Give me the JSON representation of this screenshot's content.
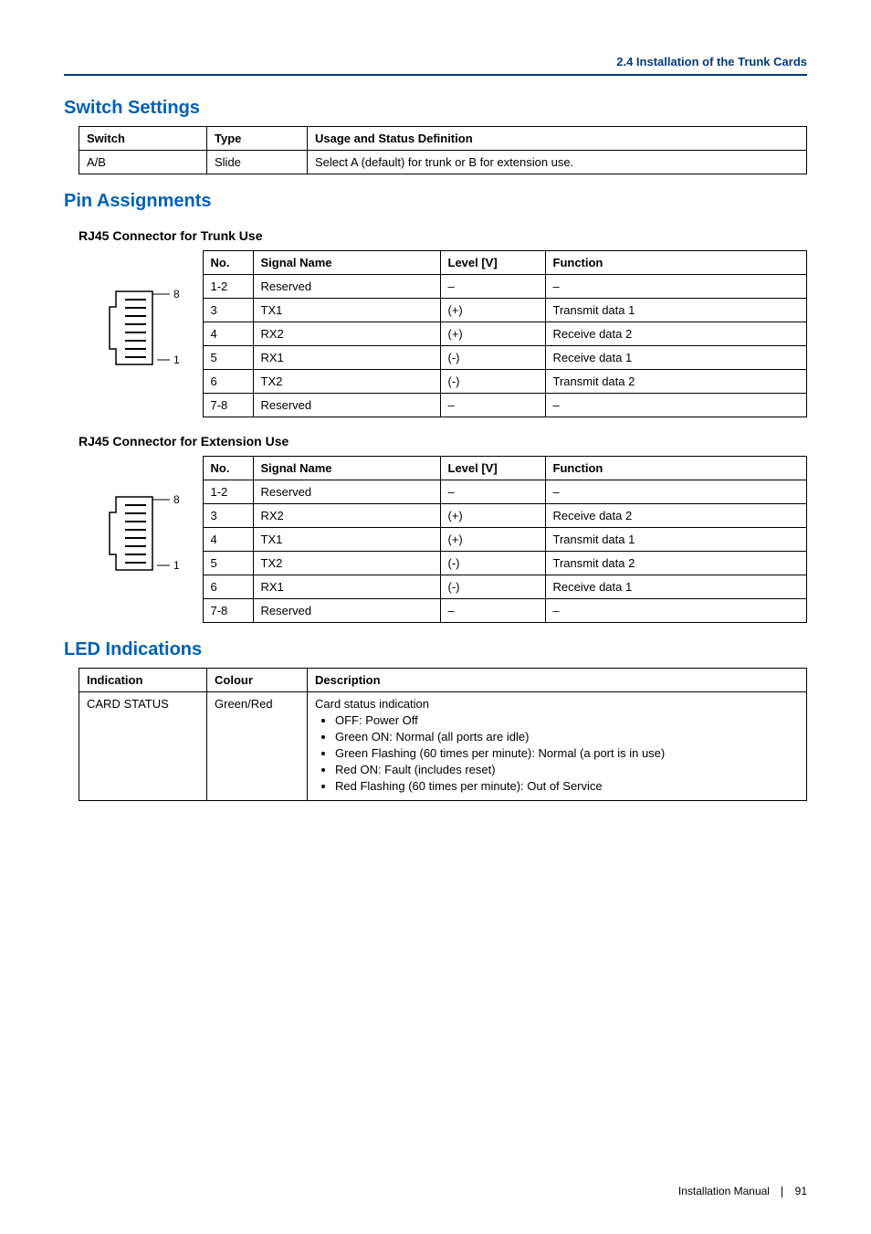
{
  "header": {
    "section_ref": "2.4 Installation of the Trunk Cards"
  },
  "switch_settings": {
    "title": "Switch Settings",
    "columns": {
      "c1": "Switch",
      "c2": "Type",
      "c3": "Usage and Status Definition"
    },
    "rows": [
      {
        "switch": "A/B",
        "type": "Slide",
        "usage": "Select A (default) for trunk or B for extension use."
      }
    ]
  },
  "pin_assignments": {
    "title": "Pin Assignments",
    "trunk": {
      "title": "RJ45 Connector for Trunk Use",
      "columns": {
        "no": "No.",
        "sig": "Signal Name",
        "lvl": "Level [V]",
        "fun": "Function"
      },
      "diagram": {
        "top": "8",
        "bottom": "1"
      },
      "rows": [
        {
          "no": "1-2",
          "sig": "Reserved",
          "lvl": "–",
          "fun": "–"
        },
        {
          "no": "3",
          "sig": "TX1",
          "lvl": "(+)",
          "fun": "Transmit data 1"
        },
        {
          "no": "4",
          "sig": "RX2",
          "lvl": "(+)",
          "fun": "Receive data 2"
        },
        {
          "no": "5",
          "sig": "RX1",
          "lvl": "(-)",
          "fun": "Receive data 1"
        },
        {
          "no": "6",
          "sig": "TX2",
          "lvl": "(-)",
          "fun": "Transmit data 2"
        },
        {
          "no": "7-8",
          "sig": "Reserved",
          "lvl": "–",
          "fun": "–"
        }
      ]
    },
    "extension": {
      "title": "RJ45 Connector for Extension Use",
      "columns": {
        "no": "No.",
        "sig": "Signal Name",
        "lvl": "Level [V]",
        "fun": "Function"
      },
      "diagram": {
        "top": "8",
        "bottom": "1"
      },
      "rows": [
        {
          "no": "1-2",
          "sig": "Reserved",
          "lvl": "–",
          "fun": "–"
        },
        {
          "no": "3",
          "sig": "RX2",
          "lvl": "(+)",
          "fun": "Receive data 2"
        },
        {
          "no": "4",
          "sig": "TX1",
          "lvl": "(+)",
          "fun": "Transmit data 1"
        },
        {
          "no": "5",
          "sig": "TX2",
          "lvl": "(-)",
          "fun": "Transmit data 2"
        },
        {
          "no": "6",
          "sig": "RX1",
          "lvl": "(-)",
          "fun": "Receive data 1"
        },
        {
          "no": "7-8",
          "sig": "Reserved",
          "lvl": "–",
          "fun": "–"
        }
      ]
    }
  },
  "led_indications": {
    "title": "LED Indications",
    "columns": {
      "c1": "Indication",
      "c2": "Colour",
      "c3": "Description"
    },
    "rows": [
      {
        "indication": "CARD STATUS",
        "colour": "Green/Red",
        "desc_lead": "Card status indication",
        "desc_items": [
          "OFF: Power Off",
          "Green ON: Normal (all ports are idle)",
          "Green Flashing (60 times per minute): Normal (a port is in use)",
          "Red ON: Fault (includes reset)",
          "Red Flashing (60 times per minute): Out of Service"
        ]
      }
    ]
  },
  "footer": {
    "doc": "Installation Manual",
    "page": "91"
  }
}
